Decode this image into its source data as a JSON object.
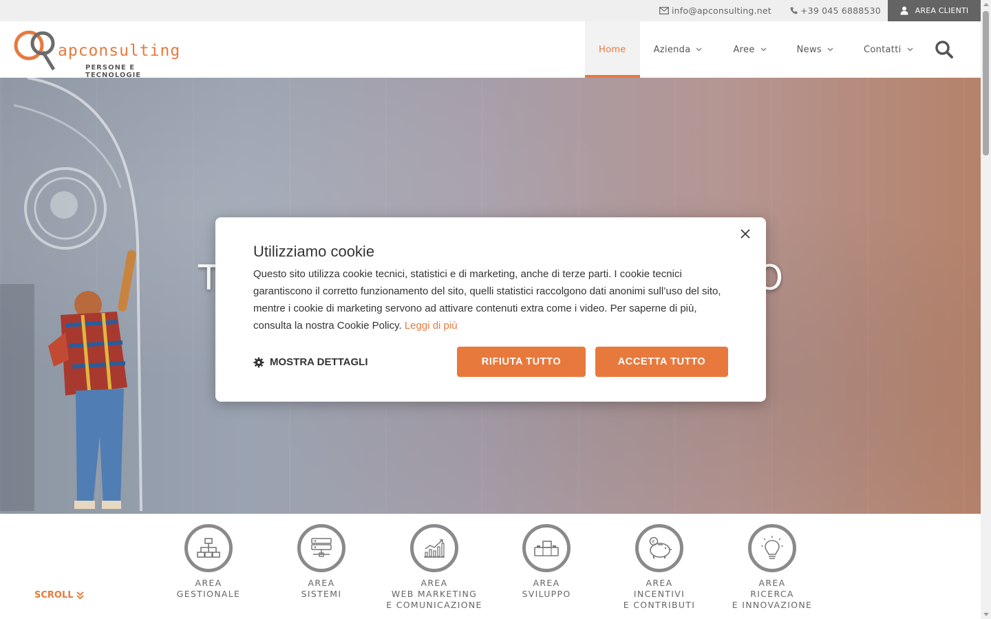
{
  "topbar": {
    "email": "info@apconsulting.net",
    "phone": "+39 045 6888530",
    "area_clienti": "AREA CLIENTI"
  },
  "logo": {
    "name": "apconsulting",
    "tagline": "PERSONE E TECNOLOGIE"
  },
  "nav": {
    "items": [
      {
        "label": "Home"
      },
      {
        "label": "Azienda"
      },
      {
        "label": "Aree"
      },
      {
        "label": "News"
      },
      {
        "label": "Contatti"
      }
    ]
  },
  "hero": {
    "title_left": "T",
    "title_right": "O"
  },
  "cookie": {
    "title": "Utilizziamo cookie",
    "body": "Questo sito utilizza cookie tecnici, statistici e di marketing, anche di terze parti. I cookie tecnici garantiscono il corretto funzionamento del sito, quelli statistici raccolgono dati anonimi sull’uso del sito, mentre i cookie di marketing servono ad attivare contenuti extra come i video. Per saperne di più, consulta la nostra Cookie Policy.",
    "link": "Leggi di più",
    "details": "MOSTRA DETTAGLI",
    "reject": "RIFIUTA TUTTO",
    "accept": "ACCETTA TUTTO"
  },
  "areas": {
    "items": [
      {
        "label": "AREA\nGESTIONALE",
        "icon": "org-chart-icon"
      },
      {
        "label": "AREA\nSISTEMI",
        "icon": "server-icon"
      },
      {
        "label": "AREA\nWEB MARKETING\nE COMUNICAZIONE",
        "icon": "growth-chart-icon"
      },
      {
        "label": "AREA\nSVILUPPO",
        "icon": "blocks-icon"
      },
      {
        "label": "AREA\nINCENTIVI\nE CONTRIBUTI",
        "icon": "piggy-bank-icon"
      },
      {
        "label": "AREA\nRICERCA\nE INNOVAZIONE",
        "icon": "lightbulb-icon"
      }
    ],
    "scroll": "SCROLL"
  },
  "colors": {
    "accent": "#e8793d",
    "topbar": "#efefef",
    "area_clienti_bg": "#646464",
    "icon_ring": "#8a8a8a"
  }
}
